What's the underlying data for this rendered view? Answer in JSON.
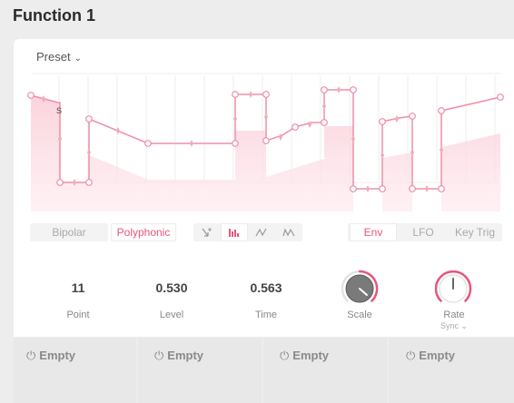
{
  "title": "Function 1",
  "preset": {
    "label": "Preset",
    "chevron": "⌄"
  },
  "envelope": {
    "fill_color": "#fbd6df",
    "line_color": "#ee8fa6",
    "handle_color": "#ffffff",
    "marker_label": "S"
  },
  "toolbar": {
    "bipolar": "Bipolar",
    "polyphonic": "Polyphonic",
    "icons": [
      "add-point-icon",
      "step-mode-icon",
      "curve-mode-icon",
      "ramp-mode-icon"
    ],
    "modes": [
      "Env",
      "LFO",
      "Key Trig"
    ],
    "active_mode": "Env"
  },
  "params": {
    "point": {
      "value": "11",
      "label": "Point"
    },
    "level": {
      "value": "0.530",
      "label": "Level"
    },
    "time": {
      "value": "0.563",
      "label": "Time"
    },
    "scale": {
      "label": "Scale"
    },
    "rate": {
      "label": "Rate",
      "sync": "Sync ⌄"
    }
  },
  "accent": "#e8557a",
  "slots": [
    {
      "label": "Empty",
      "icon": "power-icon"
    },
    {
      "label": "Empty",
      "icon": "power-icon"
    },
    {
      "label": "Empty",
      "icon": "power-icon"
    },
    {
      "label": "Empty",
      "icon": "power-icon"
    }
  ]
}
